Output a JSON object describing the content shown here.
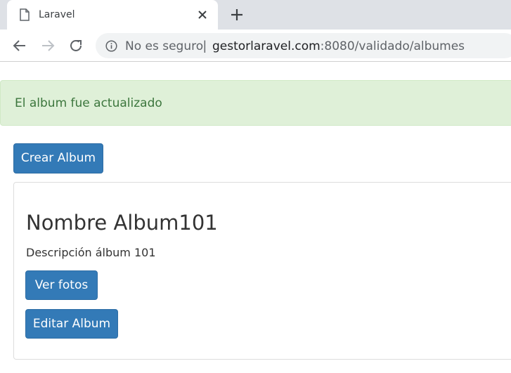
{
  "browser": {
    "tab_title": "Laravel",
    "security_label": "No es seguro",
    "separator": "|",
    "url_host": "gestorlaravel.com",
    "url_rest": ":8080/validado/albumes"
  },
  "alert": {
    "message": "El album fue actualizado",
    "color": "#3c763d",
    "background": "#dff0d8"
  },
  "actions": {
    "create_label": "Crear Album"
  },
  "album": {
    "title": "Nombre Album101",
    "description": "Descripción álbum 101",
    "view_photos_label": "Ver fotos",
    "edit_label": "Editar Album"
  },
  "colors": {
    "primary_button": "#337ab7"
  }
}
